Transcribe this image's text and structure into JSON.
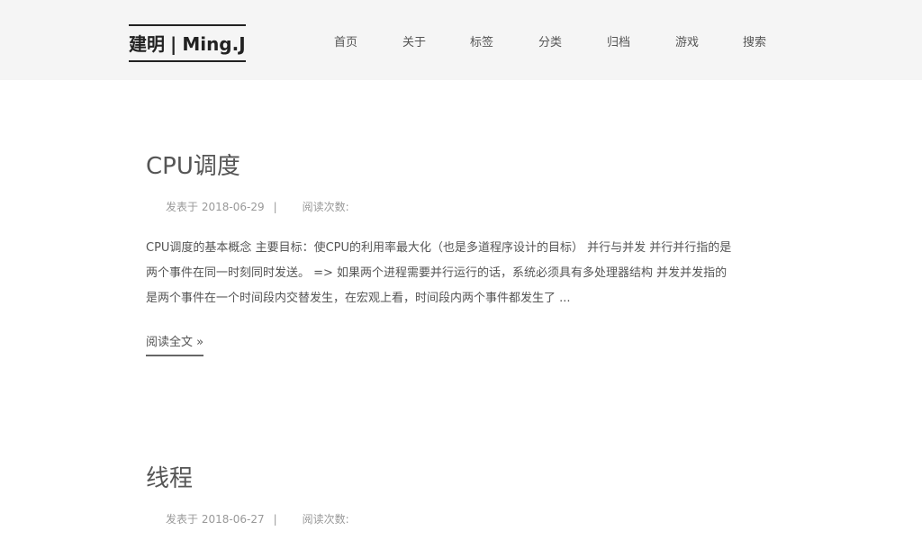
{
  "header": {
    "brand": {
      "cn": "建明",
      "separator": "|",
      "en": "Ming.J"
    },
    "nav": [
      "首页",
      "关于",
      "标签",
      "分类",
      "归档",
      "游戏",
      "搜索"
    ]
  },
  "posts": [
    {
      "title": "CPU调度",
      "posted_label": "发表于",
      "date": "2018-06-29",
      "separator": "|",
      "views_label": "阅读次数:",
      "excerpt_lines": [
        "CPU调度的基本概念 主要目标：使CPU的利用率最大化（也是多道程序设计的目标） 并行与并发 并行并行指的是",
        "两个事件在同一时刻同时发送。 => 如果两个进程需要并行运行的话，系统必须具有多处理器结构 并发并发指的",
        "是两个事件在一个时间段内交替发生，在宏观上看，时间段内两个事件都发生了 ..."
      ],
      "read_more": "阅读全文 »"
    },
    {
      "title": "线程",
      "posted_label": "发表于",
      "date": "2018-06-27",
      "separator": "|",
      "views_label": "阅读次数:"
    }
  ]
}
